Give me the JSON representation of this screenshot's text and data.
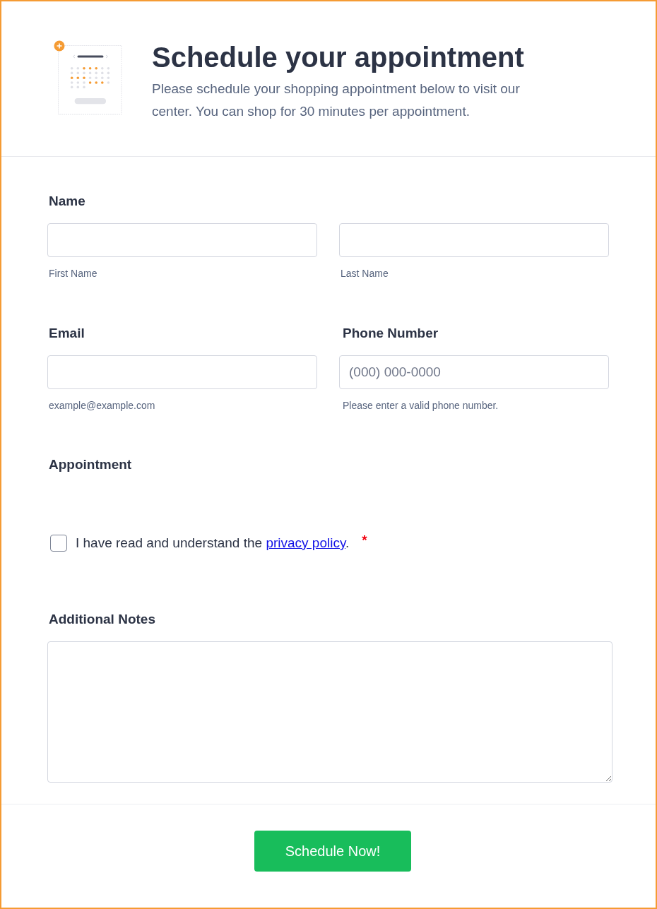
{
  "header": {
    "title": "Schedule your appointment",
    "description": "Please schedule your shopping appointment below to visit our center. You can shop for 30 minutes per appointment."
  },
  "name_field": {
    "label": "Name",
    "inputs": [
      {
        "sublabel": "First Name"
      },
      {
        "sublabel": "Last Name"
      }
    ]
  },
  "contact_fields": [
    {
      "label": "Email",
      "sublabel": "example@example.com"
    },
    {
      "label": "Phone Number",
      "placeholder": "(000) 000-0000",
      "sublabel": "Please enter a valid phone number."
    }
  ],
  "appointment": {
    "label": "Appointment"
  },
  "consent": {
    "checked": false,
    "text": "I have read and understand the ",
    "link": "privacy policy",
    "text_end": ".",
    "required_mark": "*"
  },
  "notes": {
    "label": "Additional Notes"
  },
  "submit": {
    "label": "Schedule Now!"
  }
}
